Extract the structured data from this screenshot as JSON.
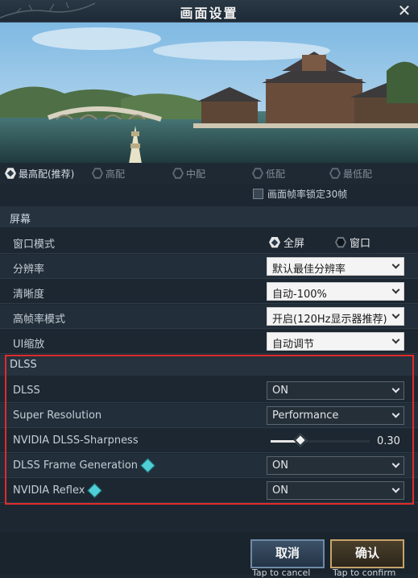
{
  "window": {
    "title": "画面设置",
    "close_icon": "close-icon"
  },
  "presets": [
    {
      "label": "最高配(推荐)",
      "selected": true
    },
    {
      "label": "高配",
      "selected": false
    },
    {
      "label": "中配",
      "selected": false
    },
    {
      "label": "低配",
      "selected": false
    },
    {
      "label": "最低配",
      "selected": false
    }
  ],
  "frame_lock": {
    "label": "画面帧率锁定30帧",
    "checked": false
  },
  "screen_section": {
    "title": "屏幕",
    "window_mode": {
      "label": "窗口模式",
      "options": [
        "全屏",
        "窗口"
      ],
      "selected": "全屏"
    },
    "resolution": {
      "label": "分辨率",
      "value": "默认最佳分辨率"
    },
    "clarity": {
      "label": "清晰度",
      "value": "自动-100%"
    },
    "high_fps": {
      "label": "高帧率模式",
      "value": "开启(120Hz显示器推荐)"
    },
    "ui_scale": {
      "label": "UI缩放",
      "value": "自动调节"
    }
  },
  "dlss_section": {
    "title": "DLSS",
    "dlss": {
      "label": "DLSS",
      "value": "ON"
    },
    "super_resolution": {
      "label": "Super Resolution",
      "value": "Performance"
    },
    "sharpness": {
      "label": "NVIDIA DLSS-Sharpness",
      "value": "0.30",
      "level": 0.3
    },
    "frame_generation": {
      "label": "DLSS Frame Generation",
      "value": "ON"
    },
    "reflex": {
      "label": "NVIDIA Reflex",
      "value": "ON"
    }
  },
  "footer": {
    "cancel": {
      "label": "取消",
      "hint": "Tap to cancel"
    },
    "confirm": {
      "label": "确认",
      "hint": "Tap to confirm"
    }
  },
  "colors": {
    "highlight_border": "#e02b2b",
    "accent_teal": "#4fd0d6",
    "background": "#1c2731"
  }
}
